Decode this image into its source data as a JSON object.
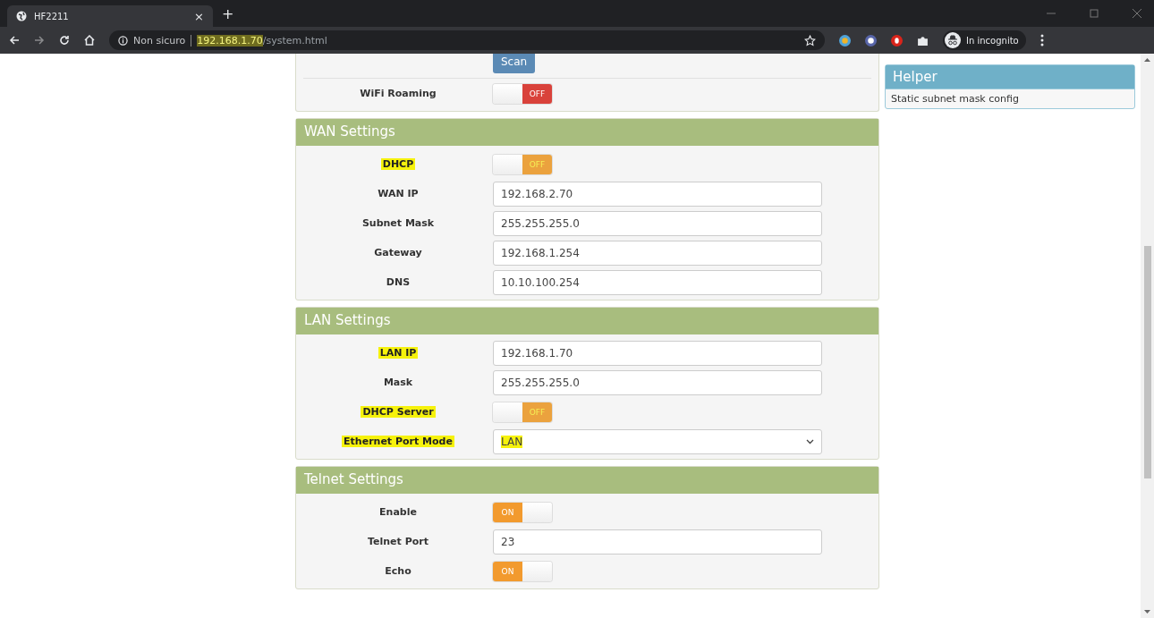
{
  "browser": {
    "tab": {
      "title": "HF2211",
      "close": "×"
    },
    "new_tab": "+",
    "address": {
      "security": "Non sicuro",
      "host": "192.168.1.70",
      "path": "/system.html",
      "host_highlighted": true
    },
    "profile": "In incognito"
  },
  "sections": [
    {
      "rows": [
        {
          "kind": "button",
          "label": "Scan"
        },
        {
          "kind": "toggle",
          "label": "WiFi Roaming",
          "highlighted": false,
          "on": false,
          "text": "OFF"
        }
      ]
    },
    {
      "title": "WAN Settings",
      "rows": [
        {
          "kind": "toggle",
          "label": "DHCP",
          "highlighted": true,
          "on": false,
          "text": "OFF"
        },
        {
          "kind": "input",
          "label": "WAN IP",
          "highlighted": false,
          "value": "192.168.2.70"
        },
        {
          "kind": "input",
          "label": "Subnet Mask",
          "highlighted": false,
          "value": "255.255.255.0"
        },
        {
          "kind": "input",
          "label": "Gateway",
          "highlighted": false,
          "value": "192.168.1.254"
        },
        {
          "kind": "input",
          "label": "DNS",
          "highlighted": false,
          "value": "10.10.100.254"
        }
      ]
    },
    {
      "title": "LAN Settings",
      "rows": [
        {
          "kind": "input",
          "label": "LAN IP",
          "highlighted": true,
          "value": "192.168.1.70"
        },
        {
          "kind": "input",
          "label": "Mask",
          "highlighted": false,
          "value": "255.255.255.0"
        },
        {
          "kind": "toggle",
          "label": "DHCP Server",
          "highlighted": true,
          "on": false,
          "text": "OFF"
        },
        {
          "kind": "select",
          "label": "Ethernet Port Mode",
          "highlighted": true,
          "value": "LAN",
          "value_highlighted": true
        }
      ]
    },
    {
      "title": "Telnet Settings",
      "rows": [
        {
          "kind": "toggle",
          "label": "Enable",
          "highlighted": false,
          "on": true,
          "text": "ON"
        },
        {
          "kind": "input",
          "label": "Telnet Port",
          "highlighted": false,
          "value": "23"
        },
        {
          "kind": "toggle",
          "label": "Echo",
          "highlighted": false,
          "on": true,
          "text": "ON"
        }
      ]
    }
  ],
  "helper": {
    "title": "Helper",
    "text": "Static subnet mask config"
  }
}
